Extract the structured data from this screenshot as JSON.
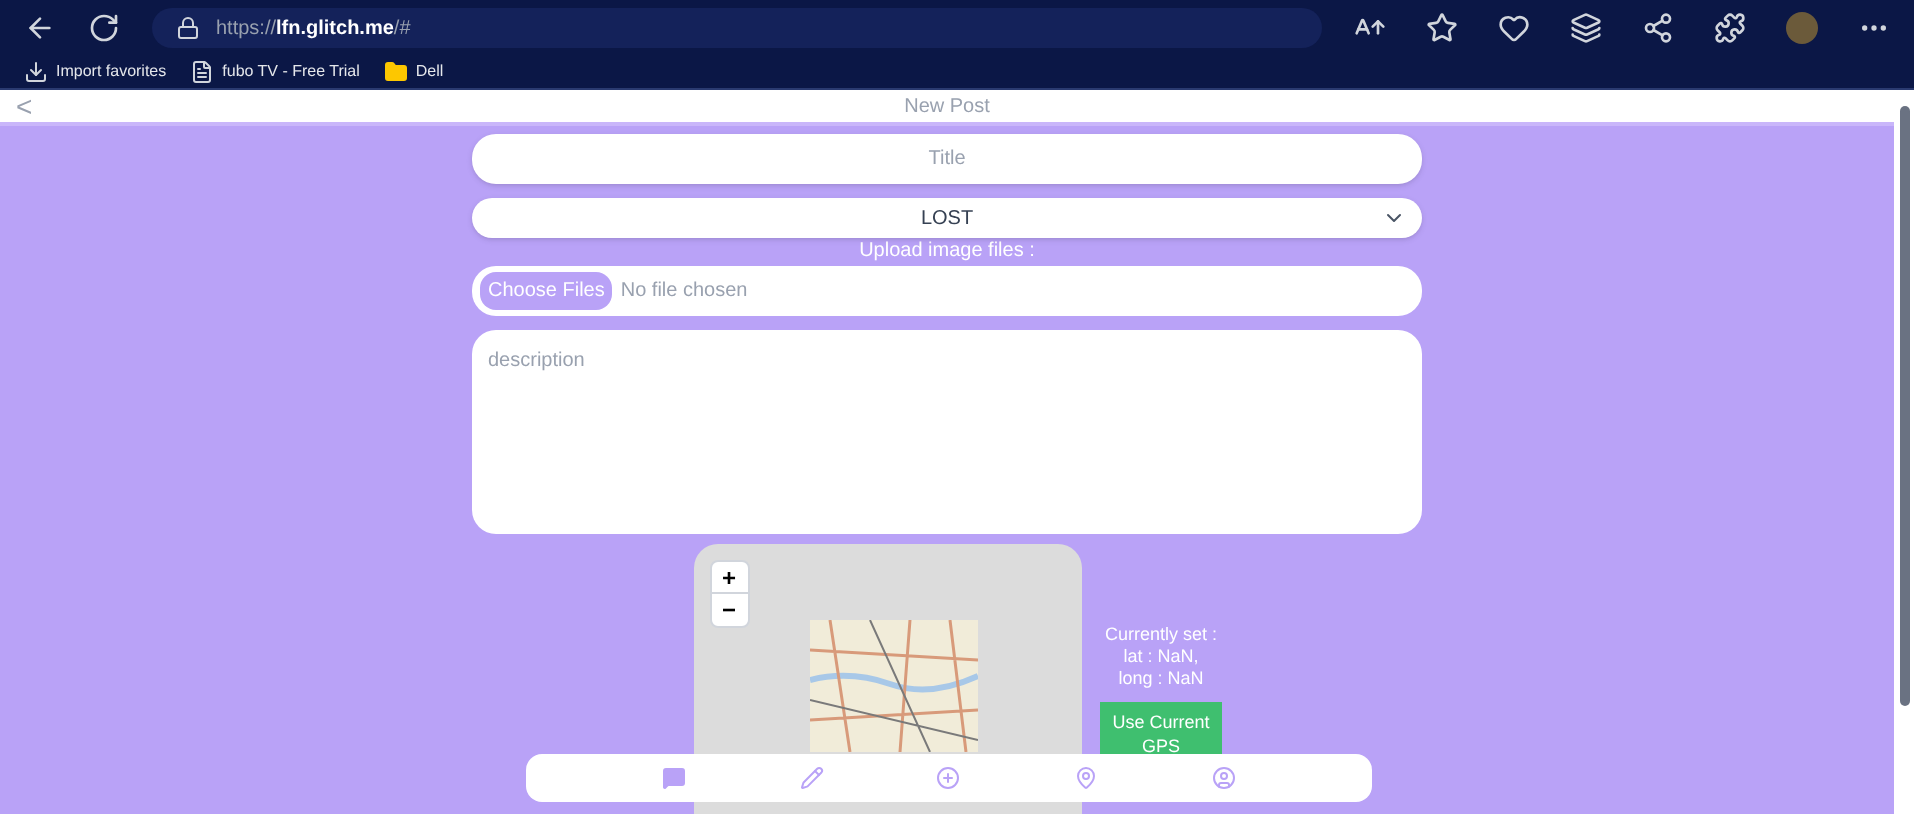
{
  "browser": {
    "url_prefix": "https://",
    "url_host": "lfn.glitch.me",
    "url_path": "/#",
    "bookmarks": [
      {
        "label": "Import favorites",
        "kind": "import"
      },
      {
        "label": "fubo TV - Free Trial",
        "kind": "page"
      },
      {
        "label": "Dell",
        "kind": "folder"
      }
    ]
  },
  "header": {
    "back": "<",
    "title": "New Post"
  },
  "form": {
    "title_placeholder": "Title",
    "category": "LOST",
    "upload_label": "Upload image files :",
    "file_button": "Choose Files",
    "file_status": "No file chosen",
    "description_placeholder": "description"
  },
  "map": {
    "zoom_in": "+",
    "zoom_out": "−",
    "location_lines": [
      "Currently set :",
      "lat : NaN,",
      "long : NaN"
    ],
    "gps_button": "Use Current GPS"
  }
}
